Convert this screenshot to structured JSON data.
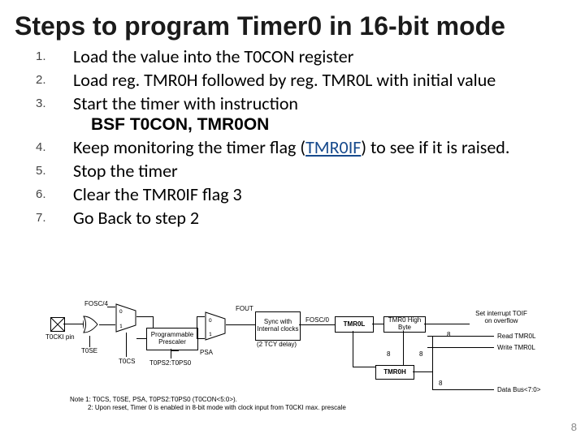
{
  "title": "Steps to program Timer0 in 16-bit mode",
  "steps": {
    "s1": "Load the value into the T0CON register",
    "s2": "Load reg. TMR0H followed by reg. TMR0L with initial value",
    "s3_a": "Start the timer with instruction",
    "s3_b": "BSF T0CON, TMR0ON",
    "s4_a": "Keep monitoring the timer flag (",
    "s4_link": "TMR0IF",
    "s4_b": ") to see if it is raised.",
    "s5": "Stop the timer",
    "s6": "Clear the TMR0IF flag 3",
    "s7": "Go Back to step 2"
  },
  "diagram": {
    "fosc": "FOSC/4",
    "t0cki": "T0CKI pin",
    "t0se": "T0SE",
    "t0cs": "T0CS",
    "prescaler": "Programmable Prescaler",
    "t0ps": "T0PS2:T0PS0",
    "psa": "PSA",
    "fout": "FOUT",
    "sync": "Sync with Internal clocks",
    "delay": "(2 TCY delay)",
    "fosc0": "FOSC/0",
    "tmr0l": "TMR0L",
    "tmr0high": "TMR0 High Byte",
    "setint": "Set interrupt TOIF on overflow",
    "read": "Read TMR0L",
    "write": "Write TMR0L",
    "tmr0h": "TMR0H",
    "databus": "Data Bus<7:0>",
    "eight1": "8",
    "eight2": "8",
    "eight3": "8",
    "eight4": "8",
    "note1": "Note 1:  T0CS, T0SE, PSA, T0PS2:T0PS0 (T0CON<5:0>).",
    "note2": "2:  Upon reset, Timer 0 is enabled in 8-bit mode with clock input from T0CKI max. prescale"
  },
  "pagenum": "8"
}
